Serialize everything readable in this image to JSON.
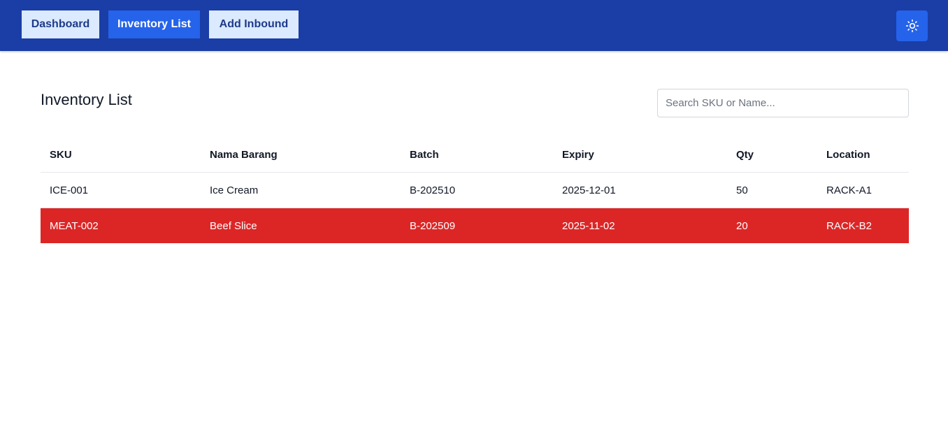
{
  "nav": {
    "items": [
      {
        "label": "Dashboard",
        "active": false
      },
      {
        "label": "Inventory List",
        "active": true
      },
      {
        "label": "Add Inbound",
        "active": false
      }
    ],
    "theme_toggle_icon": "sun-icon"
  },
  "page": {
    "title": "Inventory List"
  },
  "search": {
    "placeholder": "Search SKU or Name...",
    "value": ""
  },
  "table": {
    "headers": [
      "SKU",
      "Nama Barang",
      "Batch",
      "Expiry",
      "Qty",
      "Location"
    ],
    "rows": [
      {
        "sku": "ICE-001",
        "name": "Ice Cream",
        "batch": "B-202510",
        "expiry": "2025-12-01",
        "qty": "50",
        "location": "RACK-A1",
        "highlight": false
      },
      {
        "sku": "MEAT-002",
        "name": "Beef Slice",
        "batch": "B-202509",
        "expiry": "2025-11-02",
        "qty": "20",
        "location": "RACK-B2",
        "highlight": true
      }
    ]
  },
  "colors": {
    "topbar": "#1a3ea6",
    "nav_active": "#2563eb",
    "nav_inactive": "#dbeafe",
    "alert_row": "#dc2626"
  }
}
